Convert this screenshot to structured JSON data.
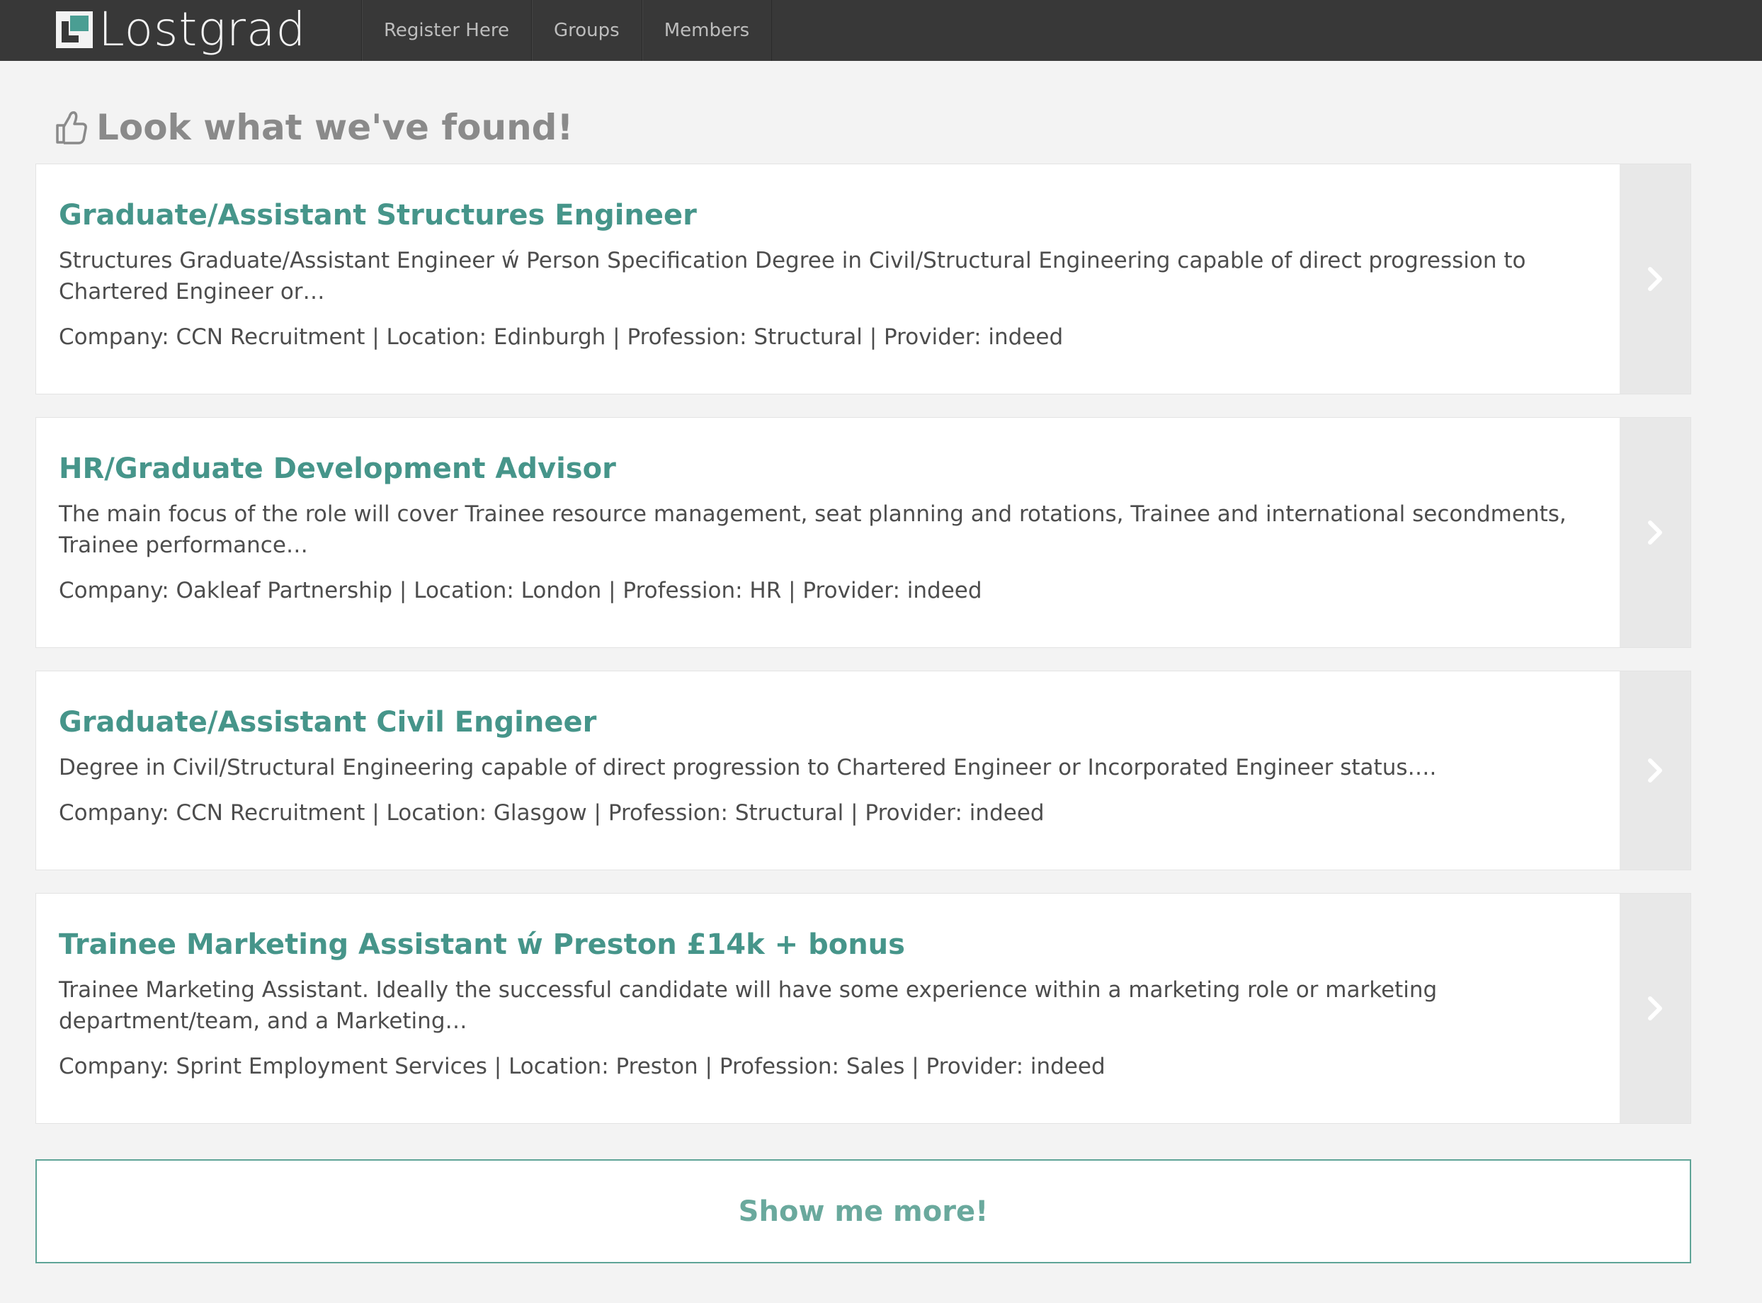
{
  "header": {
    "logo_text": "Lostgrad",
    "nav": [
      {
        "label": "Register Here"
      },
      {
        "label": "Groups"
      },
      {
        "label": "Members"
      }
    ]
  },
  "main": {
    "heading": "Look what we've found!",
    "jobs": [
      {
        "title": "Graduate/Assistant Structures Engineer",
        "description": "Structures Graduate/Assistant Engineer ẃ Person Specification Degree in Civil/Structural Engineering capable of direct progression to Chartered Engineer or…",
        "meta": "Company: CCN Recruitment | Location: Edinburgh | Profession: Structural | Provider: indeed"
      },
      {
        "title": "HR/Graduate Development Advisor",
        "description": "The main focus of the role will cover Trainee resource management, seat planning and rotations, Trainee and international secondments, Trainee performance…",
        "meta": "Company: Oakleaf Partnership | Location: London | Profession: HR | Provider: indeed"
      },
      {
        "title": "Graduate/Assistant Civil Engineer",
        "description": "Degree in Civil/Structural Engineering capable of direct progression to Chartered Engineer or Incorporated Engineer status….",
        "meta": "Company: CCN Recruitment | Location: Glasgow | Profession: Structural | Provider: indeed"
      },
      {
        "title": "Trainee Marketing Assistant ẃ Preston £14k + bonus",
        "description": "Trainee Marketing Assistant. Ideally the successful candidate will have some experience within a marketing role or marketing department/team, and a Marketing…",
        "meta": "Company: Sprint Employment Services | Location: Preston | Profession: Sales | Provider: indeed"
      }
    ],
    "more_label": "Show me more!"
  },
  "icons": {
    "logo": "lostgrad-logo-icon",
    "heading": "thumbs-up-icon",
    "arrow": "chevron-right-icon"
  },
  "colors": {
    "topbar": "#383838",
    "accent": "#46958a",
    "background": "#f3f3f3"
  }
}
